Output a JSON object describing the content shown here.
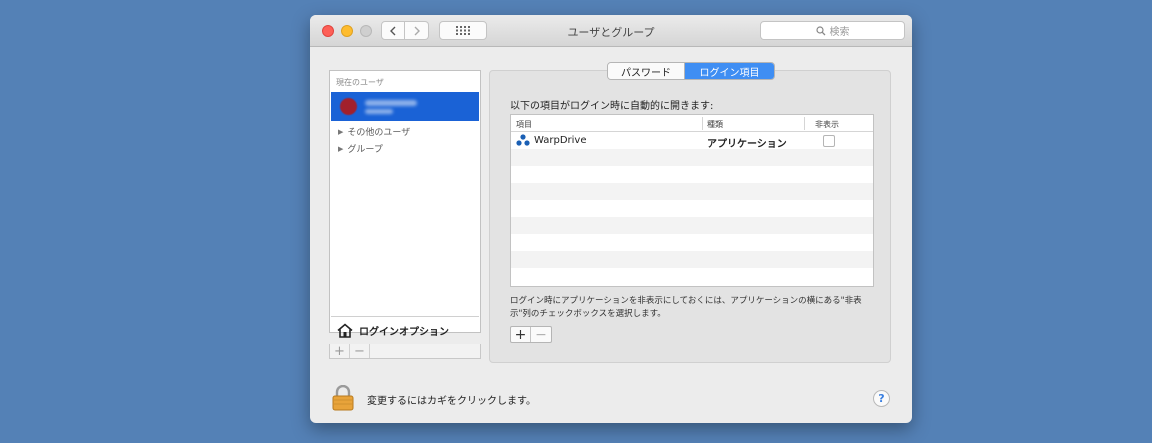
{
  "window": {
    "title": "ユーザとグループ"
  },
  "toolbar": {
    "search_placeholder": "検索"
  },
  "sidebar": {
    "section_header": "現在のユーザ",
    "tree_items": [
      "その他のユーザ",
      "グループ"
    ],
    "login_options_label": "ログインオプション",
    "add_label": "+",
    "remove_label": "−"
  },
  "tabs": {
    "password": "パスワード",
    "login_items": "ログイン項目"
  },
  "panel": {
    "heading": "以下の項目がログイン時に自動的に開きます:",
    "columns": {
      "item": "項目",
      "kind": "種類",
      "hide": "非表示"
    },
    "rows": [
      {
        "name": "WarpDrive",
        "kind": "アプリケーション",
        "hidden": false
      }
    ],
    "hint": "ログイン時にアプリケーションを非表示にしておくには、アプリケーションの横にある\"非表示\"列のチェックボックスを選択します。",
    "add_label": "+",
    "remove_label": "−"
  },
  "footer": {
    "lock_text": "変更するにはカギをクリックします。",
    "help_label": "?"
  },
  "colors": {
    "desktop": "#5481b6",
    "selection": "#1a62d6",
    "tab_active": "#3f8ef3"
  }
}
